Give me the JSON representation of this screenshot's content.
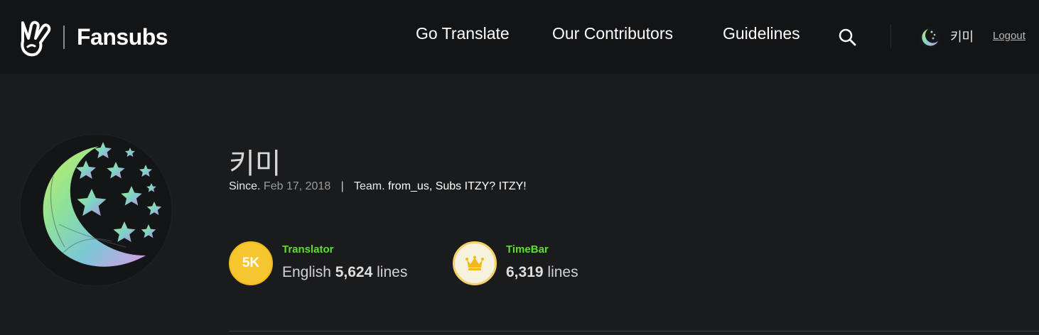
{
  "header": {
    "brand": "Fansubs",
    "nav": [
      {
        "label": "Go Translate"
      },
      {
        "label": "Our Contributors"
      },
      {
        "label": "Guidelines"
      }
    ],
    "search_icon": "search-icon",
    "user": {
      "name": "키미",
      "logout_label": "Logout"
    }
  },
  "profile": {
    "name": "키미",
    "since_label": "Since.",
    "since_date": "Feb 17, 2018",
    "team_label": "Team.",
    "team_value": "from_us, Subs ITZY? ITZY!"
  },
  "stats": [
    {
      "badge": "5K",
      "title": "Translator",
      "language": "English",
      "count": "5,624",
      "unit": "lines"
    },
    {
      "badge_icon": "crown-icon",
      "title": "TimeBar",
      "count": "6,319",
      "unit": "lines"
    }
  ],
  "colors": {
    "accent_green": "#5ce02f",
    "badge_gold": "#f6c630",
    "background": "#1a1b1d"
  }
}
